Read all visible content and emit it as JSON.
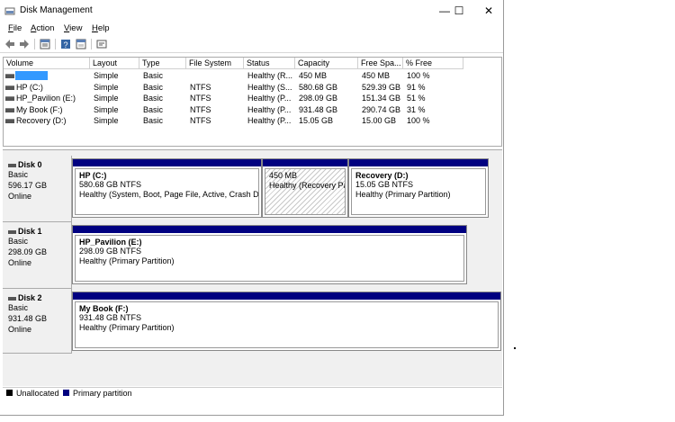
{
  "window": {
    "title": "Disk Management",
    "controls": {
      "minimize": "—",
      "maximize": "☐",
      "close": "✕"
    }
  },
  "menu": [
    {
      "accel": "F",
      "rest": "ile"
    },
    {
      "accel": "A",
      "rest": "ction"
    },
    {
      "accel": "V",
      "rest": "iew"
    },
    {
      "accel": "H",
      "rest": "elp"
    }
  ],
  "toolbar_icons": [
    "back-arrow-icon",
    "forward-arrow-icon",
    "properties-icon",
    "help-icon",
    "show-hide-icon",
    "console-icon"
  ],
  "volume_list": {
    "columns": [
      "Volume",
      "Layout",
      "Type",
      "File System",
      "Status",
      "Capacity",
      "Free Spa...",
      "% Free"
    ],
    "rows": [
      {
        "volume": "",
        "layout": "Simple",
        "type": "Basic",
        "fs": "",
        "status": "Healthy (R...",
        "capacity": "450 MB",
        "free": "450 MB",
        "pct": "100 %"
      },
      {
        "volume": "HP (C:)",
        "layout": "Simple",
        "type": "Basic",
        "fs": "NTFS",
        "status": "Healthy (S...",
        "capacity": "580.68 GB",
        "free": "529.39 GB",
        "pct": "91 %"
      },
      {
        "volume": "HP_Pavilion (E:)",
        "layout": "Simple",
        "type": "Basic",
        "fs": "NTFS",
        "status": "Healthy (P...",
        "capacity": "298.09 GB",
        "free": "151.34 GB",
        "pct": "51 %"
      },
      {
        "volume": "My Book (F:)",
        "layout": "Simple",
        "type": "Basic",
        "fs": "NTFS",
        "status": "Healthy (P...",
        "capacity": "931.48 GB",
        "free": "290.74 GB",
        "pct": "31 %"
      },
      {
        "volume": "Recovery (D:)",
        "layout": "Simple",
        "type": "Basic",
        "fs": "NTFS",
        "status": "Healthy (P...",
        "capacity": "15.05 GB",
        "free": "15.00 GB",
        "pct": "100 %"
      }
    ]
  },
  "disks": [
    {
      "name": "Disk 0",
      "type": "Basic",
      "size": "596.17 GB",
      "state": "Online",
      "partitions": [
        {
          "name": "HP  (C:)",
          "size": "580.68 GB NTFS",
          "status": "Healthy (System, Boot, Page File, Active, Crash Dur"
        },
        {
          "name": "",
          "size": "450 MB",
          "status": "Healthy (Recovery Par"
        },
        {
          "name": "Recovery  (D:)",
          "size": "15.05 GB NTFS",
          "status": "Healthy (Primary Partition)"
        }
      ]
    },
    {
      "name": "Disk 1",
      "type": "Basic",
      "size": "298.09 GB",
      "state": "Online",
      "partitions": [
        {
          "name": "HP_Pavilion  (E:)",
          "size": "298.09 GB NTFS",
          "status": "Healthy (Primary Partition)"
        }
      ]
    },
    {
      "name": "Disk 2",
      "type": "Basic",
      "size": "931.48 GB",
      "state": "Online",
      "partitions": [
        {
          "name": "My Book  (F:)",
          "size": "931.48 GB NTFS",
          "status": "Healthy (Primary Partition)"
        }
      ]
    }
  ],
  "legend": [
    {
      "label": "Unallocated",
      "color": "#000000"
    },
    {
      "label": "Primary partition",
      "color": "#000080"
    }
  ],
  "colors": {
    "primary_bar": "#000080",
    "selection": "#3399ff"
  }
}
